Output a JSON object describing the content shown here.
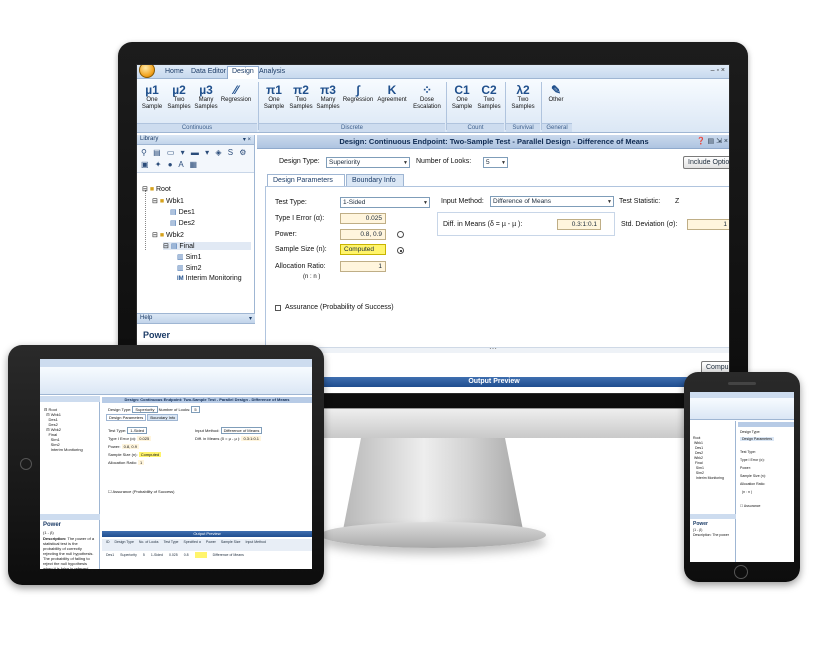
{
  "app": {
    "menu_tabs": [
      "Home",
      "Data Editor",
      "Design",
      "Analysis"
    ],
    "active_tab": "Design",
    "window_controls": "–  ▫  ×"
  },
  "ribbon": {
    "continuous": [
      {
        "label": "One\nSample",
        "icon": "µ1",
        "icon_name": "one-sample-mean-icon"
      },
      {
        "label": "Two\nSamples",
        "icon": "µ2",
        "icon_name": "two-samples-mean-icon"
      },
      {
        "label": "Many\nSamples",
        "icon": "µ3",
        "icon_name": "many-samples-mean-icon"
      },
      {
        "label": "Regression",
        "icon": "⁄⁄",
        "icon_name": "regression-icon"
      }
    ],
    "discrete": [
      {
        "label": "One\nSample",
        "icon": "π1",
        "icon_name": "one-sample-proportion-icon"
      },
      {
        "label": "Two\nSamples",
        "icon": "π2",
        "icon_name": "two-samples-proportion-icon"
      },
      {
        "label": "Many\nSamples",
        "icon": "π3",
        "icon_name": "many-samples-proportion-icon"
      },
      {
        "label": "Regression",
        "icon": "∫",
        "icon_name": "logistic-regression-icon"
      },
      {
        "label": "Agreement",
        "icon": "K",
        "icon_name": "agreement-kappa-icon"
      },
      {
        "label": "Dose\nEscalation",
        "icon": "⁘",
        "icon_name": "dose-escalation-icon"
      }
    ],
    "count": [
      {
        "label": "One\nSample",
        "icon": "C1",
        "icon_name": "one-sample-count-icon"
      },
      {
        "label": "Two\nSamples",
        "icon": "C2",
        "icon_name": "two-samples-count-icon"
      }
    ],
    "survival": [
      {
        "label": "Two\nSamples",
        "icon": "λ2",
        "icon_name": "two-samples-survival-icon"
      }
    ],
    "general": [
      {
        "label": "Other",
        "icon": "✎",
        "icon_name": "other-design-icon"
      }
    ],
    "group_labels": {
      "continuous": "Continuous",
      "discrete": "Discrete",
      "count": "Count",
      "survival": "Survival",
      "general": "General"
    }
  },
  "library": {
    "title": "Library",
    "pin": "▾ ×",
    "toolbar_glyphs": "⚲ ▤ ▭ ▾ ▬ ▾ ◈ S ⚙",
    "toolbar_glyphs2": "▣ ✦ ● A ▦",
    "tree": {
      "root": "Root",
      "wbk1": "Wbk1",
      "des1": "Des1",
      "des2": "Des2",
      "wbk2": "Wbk2",
      "final": "Final",
      "sim1": "Sim1",
      "sim2": "Sim2",
      "interim": "Interim Monitoring",
      "im_badge": "IM"
    },
    "help_head": "Help",
    "help_title": "Power"
  },
  "design": {
    "title": "Design: Continuous Endpoint: Two-Sample Test - Parallel Design - Difference of Means",
    "title_icons": "❓ ▤ ⇲ ×",
    "design_type_label": "Design Type:",
    "design_type_value": "Superiority",
    "num_looks_label": "Number of Looks:",
    "num_looks_value": "5",
    "include_options": "Include Optio",
    "tabs": [
      "Design Parameters",
      "Boundary Info"
    ],
    "test_type_label": "Test Type:",
    "test_type_value": "1-Sided",
    "type1_label": "Type I Error (α):",
    "type1_value": "0.025",
    "power_label": "Power:",
    "power_value": "0.8, 0.9",
    "sample_size_label": "Sample Size (n):",
    "sample_size_value": "Computed",
    "alloc_label": "Allocation Ratio:",
    "alloc_sub": "(n  : n  )",
    "alloc_sub_t": "t",
    "alloc_sub_c": "c",
    "alloc_value": "1",
    "input_method_label": "Input Method:",
    "input_method_value": "Difference of Means",
    "test_stat_label": "Test Statistic:",
    "test_stat_value": "Z",
    "diff_means_label": "Diff. in Means (δ = µ  - µ ):",
    "diff_means_sub_t": "t",
    "diff_means_sub_c": "c",
    "diff_means_value": "0.3:1:0.1",
    "std_dev_label": "Std. Deviation (σ):",
    "std_dev_value": "1",
    "assurance_label": "Assurance (Probability of Success)",
    "compute_button": "Compu",
    "output_preview": "Output Preview",
    "scroll_handle": "⋯"
  },
  "tablet": {
    "help_title": "Power",
    "help_sub": "(1 - β)",
    "help_desc_label": "Description:",
    "help_desc": "The power of a statistical test is the probability of correctly rejecting the null hypothesis. The probability of failing to reject the null hypothesis when it is false is referred",
    "output_title": "Output Preview",
    "table_headers": [
      "ID",
      "Design Type",
      "No. of Looks",
      "Test Type",
      "Specified α",
      "Power",
      "Sample Size",
      "Input Method"
    ],
    "table_row": [
      "Des1",
      "Superiority",
      "5",
      "1-Sided",
      "0.025",
      "0.8",
      "",
      "Difference of Means"
    ]
  },
  "phone": {
    "help_title": "Power",
    "help_sub": "(1 - β)",
    "help_desc": "Description: The power",
    "labels": [
      "Test Type:",
      "Type I Error (α):",
      "Power:",
      "Sample Size (n):",
      "Allocation Ratio:",
      "(n  : n  )",
      "Assurance"
    ]
  }
}
